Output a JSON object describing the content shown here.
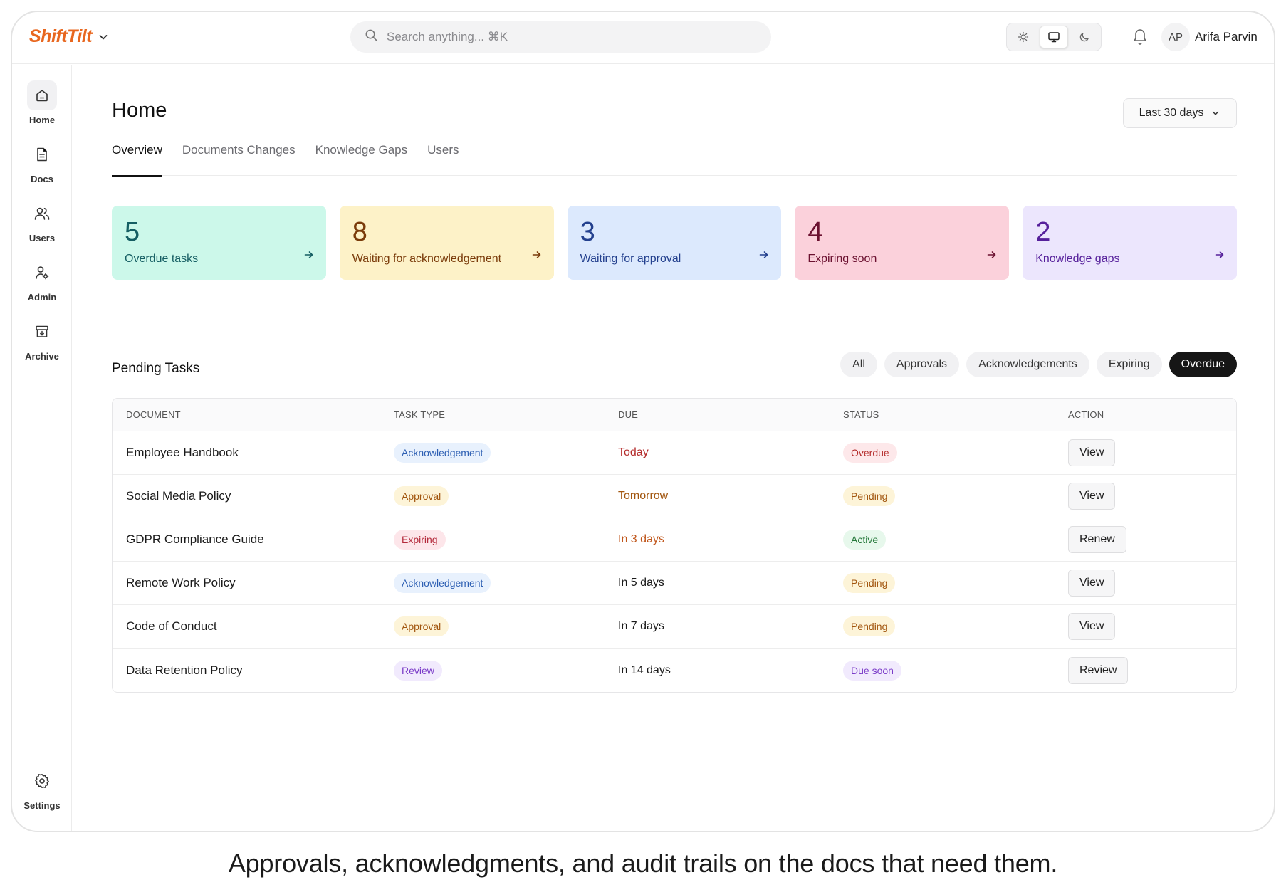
{
  "app": {
    "brand": "ShiftTilt",
    "tagline": "Approvals, acknowledgments, and audit trails on the docs that need them."
  },
  "colors": {
    "brand": "#e8671f"
  },
  "topbar": {
    "search_placeholder": "Search anything... ⌘K",
    "theme_selected": "system",
    "user_initials": "AP",
    "user_name": "Arifa Parvin"
  },
  "sidebar": {
    "items": [
      {
        "label": "Home",
        "icon": "home-icon",
        "active": true
      },
      {
        "label": "Docs",
        "icon": "document-icon",
        "active": false
      },
      {
        "label": "Users",
        "icon": "users-icon",
        "active": false
      },
      {
        "label": "Admin",
        "icon": "admin-icon",
        "active": false
      },
      {
        "label": "Archive",
        "icon": "archive-icon",
        "active": false
      }
    ],
    "settings_label": "Settings"
  },
  "main": {
    "title": "Home",
    "range": "Last 30 days",
    "tabs": [
      {
        "label": "Overview"
      },
      {
        "label": "Documents Changes"
      },
      {
        "label": "Knowledge Gaps"
      },
      {
        "label": "Users"
      }
    ],
    "active_tab": "Overview"
  },
  "stats": [
    {
      "value": "5",
      "label": "Overdue tasks",
      "bg": "#ccf8ea",
      "fg": "#155e63"
    },
    {
      "value": "8",
      "label": "Waiting for acknowledgement",
      "bg": "#fdf2c8",
      "fg": "#7a3b0a"
    },
    {
      "value": "3",
      "label": "Waiting for approval",
      "bg": "#dce9fd",
      "fg": "#23408e"
    },
    {
      "value": "4",
      "label": "Expiring soon",
      "bg": "#fbd1db",
      "fg": "#6b1130"
    },
    {
      "value": "2",
      "label": "Knowledge gaps",
      "bg": "#ece6fd",
      "fg": "#56209b"
    }
  ],
  "tasks": {
    "title": "Pending Tasks",
    "filters": [
      {
        "label": "All"
      },
      {
        "label": "Approvals"
      },
      {
        "label": "Acknowledgements"
      },
      {
        "label": "Expiring"
      },
      {
        "label": "Overdue"
      }
    ],
    "active_filter": "Overdue",
    "columns": [
      "DOCUMENT",
      "TASK TYPE",
      "DUE",
      "STATUS",
      "ACTION"
    ],
    "rows": [
      {
        "document": "Employee Handbook",
        "type": "Acknowledgement",
        "due": "Today",
        "status": "Overdue",
        "action": "View"
      },
      {
        "document": "Social Media Policy",
        "type": "Approval",
        "due": "Tomorrow",
        "status": "Pending",
        "action": "View"
      },
      {
        "document": "GDPR Compliance Guide",
        "type": "Expiring",
        "due": "In 3 days",
        "status": "Active",
        "action": "Renew"
      },
      {
        "document": "Remote Work Policy",
        "type": "Acknowledgement",
        "due": "In 5 days",
        "status": "Pending",
        "action": "View"
      },
      {
        "document": "Code of Conduct",
        "type": "Approval",
        "due": "In 7 days",
        "status": "Pending",
        "action": "View"
      },
      {
        "document": "Data Retention Policy",
        "type": "Review",
        "due": "In 14 days",
        "status": "Due soon",
        "action": "Review"
      }
    ]
  },
  "pill_styles": {
    "Acknowledgement": {
      "bg": "#e8f1fd",
      "fg": "#2d5fb3"
    },
    "Approval": {
      "bg": "#fdf4d8",
      "fg": "#a2560f"
    },
    "Expiring": {
      "bg": "#fde6ea",
      "fg": "#b42b3c"
    },
    "Review": {
      "bg": "#f1eafd",
      "fg": "#7a3bc8"
    },
    "Overdue": {
      "bg": "#fde8ea",
      "fg": "#b42b2b"
    },
    "Pending": {
      "bg": "#fdf4d8",
      "fg": "#a2560f"
    },
    "Active": {
      "bg": "#e7f8ec",
      "fg": "#277a3c"
    },
    "Due soon": {
      "bg": "#f1eafd",
      "fg": "#7a3bc8"
    }
  },
  "due_colors": {
    "Today": "#b42b2b",
    "Tomorrow": "#a2560f",
    "In 3 days": "#c0561b",
    "default": "#1a1a1a"
  }
}
